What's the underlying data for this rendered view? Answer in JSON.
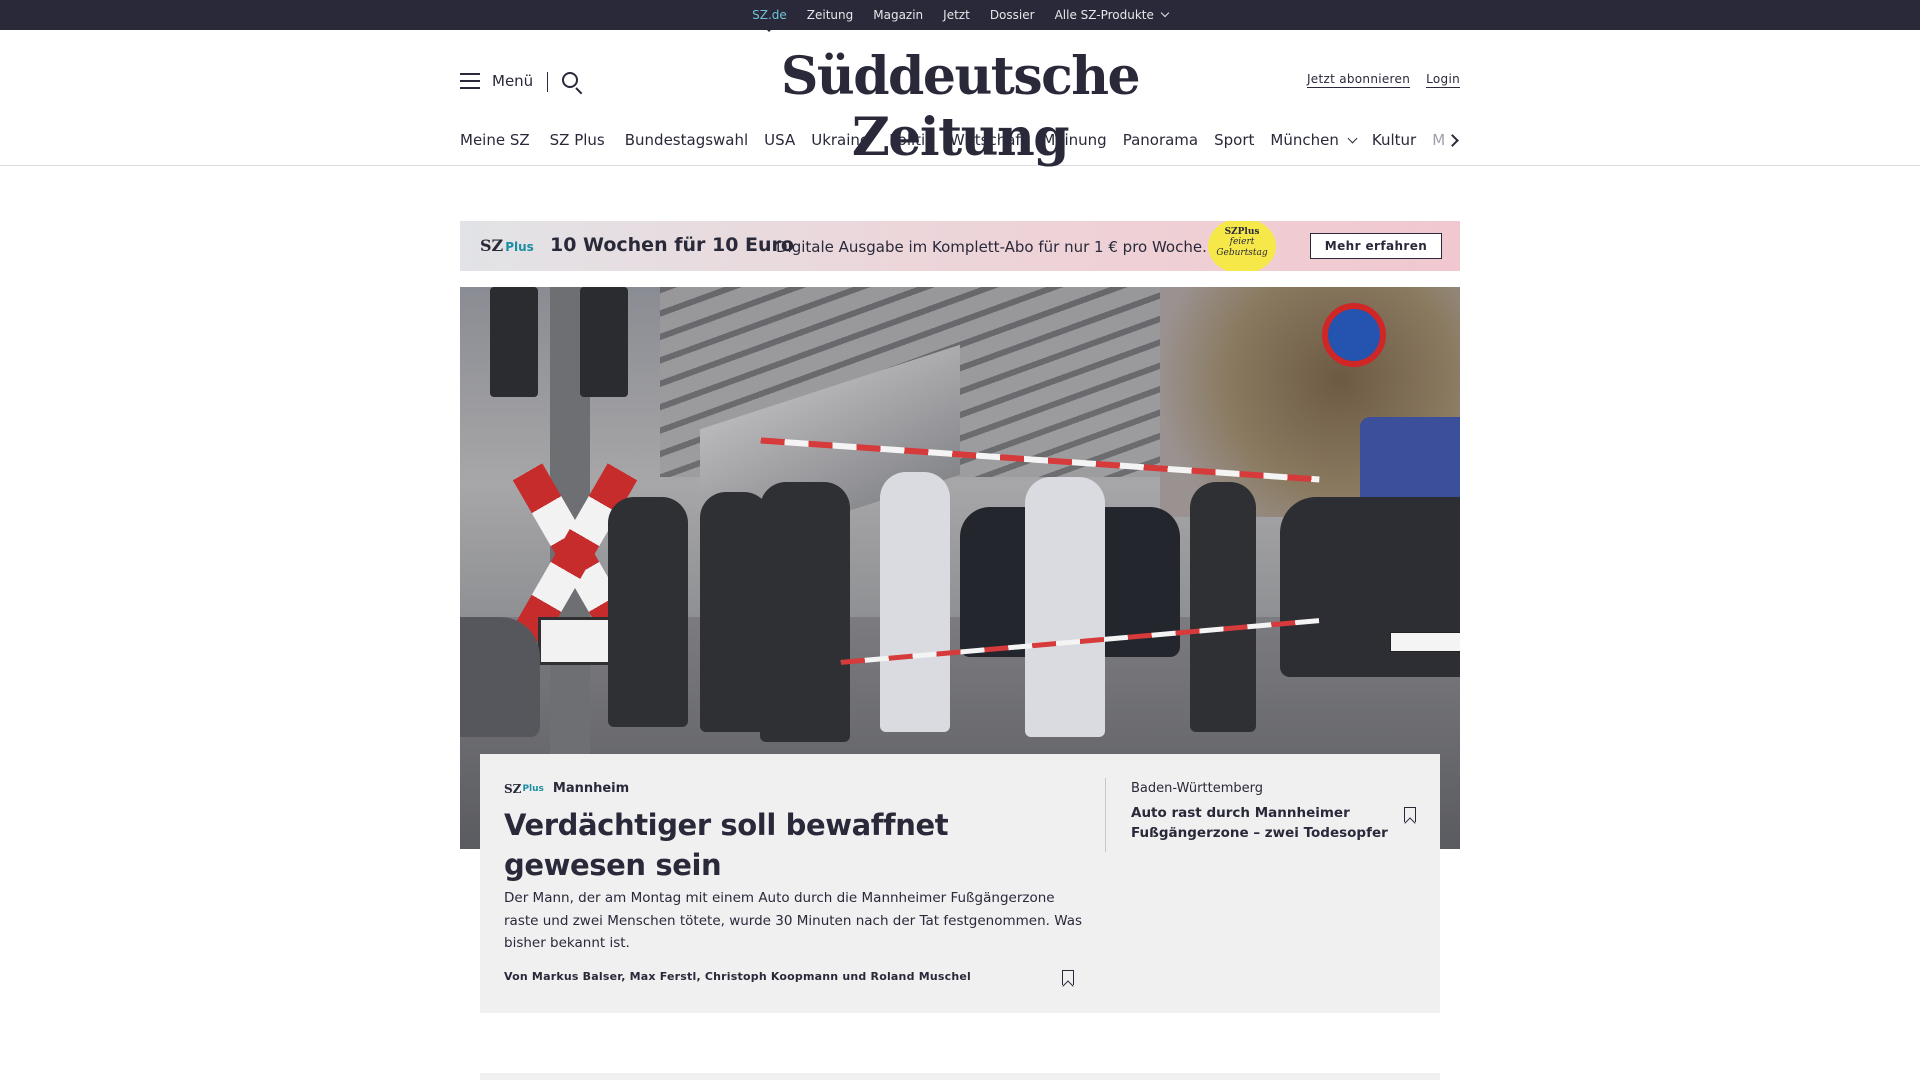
{
  "service_bar": {
    "items": [
      "SZ.de",
      "Zeitung",
      "Magazin",
      "Jetzt",
      "Dossier",
      "Alle SZ-Produkte"
    ]
  },
  "header": {
    "menu_label": "Menü",
    "logo": "Süddeutsche Zeitung",
    "subscribe": "Jetzt abonnieren",
    "login": "Login"
  },
  "nav": {
    "items": [
      "Meine SZ",
      "SZ Plus",
      "Bundestagswahl",
      "USA",
      "Ukraine",
      "Politik",
      "Wirtschaft",
      "Meinung",
      "Panorama",
      "Sport",
      "München",
      "Kultur",
      "M"
    ]
  },
  "promo": {
    "brand": "SZ",
    "brand_plus": "Plus",
    "headline": "10 Wochen für 10 Euro",
    "subline": "Digitale Ausgabe im Komplett-Abo für nur 1 € pro Woche.",
    "badge_line1": "SZPlus",
    "badge_line2": "feiert",
    "badge_line3": "Geburtstag",
    "cta": "Mehr erfahren"
  },
  "lead": {
    "brand": "SZ",
    "brand_plus": "Plus",
    "topic": "Mannheim",
    "title": "Verdächtiger soll bewaffnet gewesen sein",
    "text": "Der Mann, der am Montag mit einem Auto durch die Mannheimer Fußgängerzone raste und zwei Menschen tötete, wurde 30 Minuten nach der Tat festgenommen. Was bisher bekannt ist.",
    "authors": "Von Markus Balser, Max Ferstl, Christoph Koopmann und Roland Muschel"
  },
  "side": {
    "kicker": "Baden-Württemberg",
    "title": "Auto rast durch Mannheimer Fußgängerzone – zwei Todesopfer"
  },
  "colors": {
    "ink": "#29293a",
    "service_bar_bg": "#29293a",
    "accent_teal": "#1a8fa3",
    "teaser_bg": "#f0f0f1",
    "badge_yellow": "#f7e84a"
  }
}
